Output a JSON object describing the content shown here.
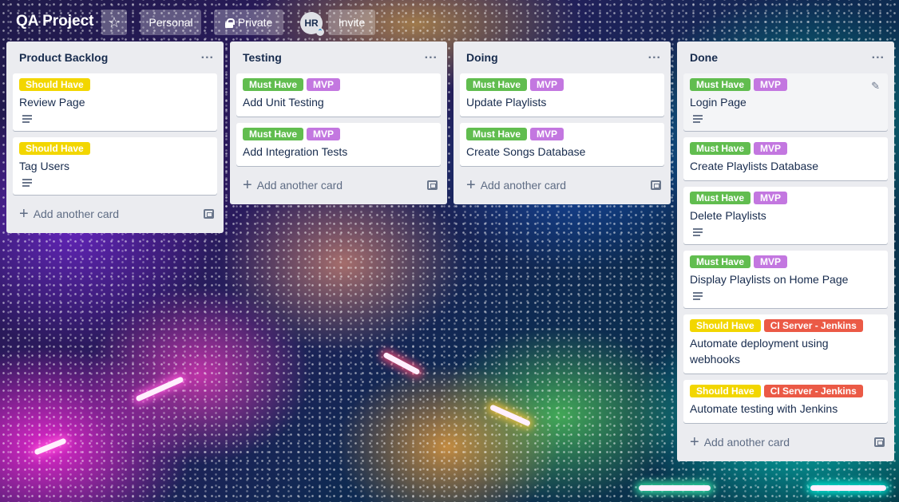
{
  "header": {
    "board_title": "QA Project",
    "personal_label": "Personal",
    "private_label": "Private",
    "avatar_initials": "HR",
    "invite_label": "Invite"
  },
  "icons": {
    "star": "star-icon",
    "lock": "lock-icon",
    "list_menu": "ellipsis-icon",
    "plus": "plus-icon",
    "template": "card-template-icon",
    "description": "description-icon",
    "edit": "pencil-icon"
  },
  "label_colors": {
    "Should Have": "#f2d600",
    "Must Have": "#61bd4f",
    "MVP": "#c377e0",
    "CI Server - Jenkins": "#eb5a46"
  },
  "lists": [
    {
      "title": "Product Backlog",
      "add_card": "Add another card",
      "cards": [
        {
          "labels": [
            "Should Have"
          ],
          "title": "Review Page",
          "has_description": true
        },
        {
          "labels": [
            "Should Have"
          ],
          "title": "Tag Users",
          "has_description": true
        }
      ]
    },
    {
      "title": "Testing",
      "add_card": "Add another card",
      "cards": [
        {
          "labels": [
            "Must Have",
            "MVP"
          ],
          "title": "Add Unit Testing"
        },
        {
          "labels": [
            "Must Have",
            "MVP"
          ],
          "title": "Add Integration Tests"
        }
      ]
    },
    {
      "title": "Doing",
      "add_card": "Add another card",
      "cards": [
        {
          "labels": [
            "Must Have",
            "MVP"
          ],
          "title": "Update Playlists"
        },
        {
          "labels": [
            "Must Have",
            "MVP"
          ],
          "title": "Create Songs Database"
        }
      ]
    },
    {
      "title": "Done",
      "add_card": "Add another card",
      "cards": [
        {
          "labels": [
            "Must Have",
            "MVP"
          ],
          "title": "Login Page",
          "has_description": true
        },
        {
          "labels": [
            "Must Have",
            "MVP"
          ],
          "title": "Create Playlists Database"
        },
        {
          "labels": [
            "Must Have",
            "MVP"
          ],
          "title": "Delete Playlists",
          "has_description": true
        },
        {
          "labels": [
            "Must Have",
            "MVP"
          ],
          "title": "Display Playlists on Home Page",
          "has_description": true
        },
        {
          "labels": [
            "Should Have",
            "CI Server - Jenkins"
          ],
          "title": "Automate deployment using webhooks"
        },
        {
          "labels": [
            "Should Have",
            "CI Server - Jenkins"
          ],
          "title": "Automate testing with Jenkins"
        }
      ]
    }
  ]
}
